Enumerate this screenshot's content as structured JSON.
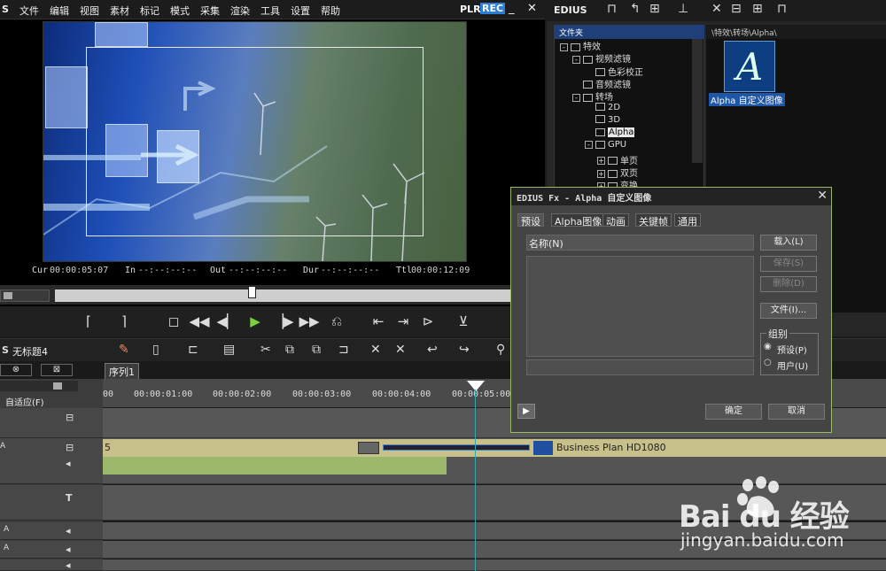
{
  "menu": [
    "S",
    "文件",
    "编辑",
    "视图",
    "素材",
    "标记",
    "模式",
    "采集",
    "渲染",
    "工具",
    "设置",
    "帮助"
  ],
  "plr": "PLR",
  "rec": "REC",
  "timecode": {
    "cur_label": "Cur",
    "cur": "00:00:05:07",
    "in_label": "In",
    "in": "--:--:--:--",
    "out_label": "Out",
    "out": "--:--:--:--",
    "dur_label": "Dur",
    "dur": "--:--:--:--",
    "ttl_label": "Ttl",
    "ttl": "00:00:12:09"
  },
  "bin": {
    "title": "EDIUS",
    "tree_header": "文件夹",
    "path": "\\特效\\转场\\Alpha\\",
    "tree": [
      {
        "label": "特效",
        "indent": 0,
        "box": "-"
      },
      {
        "label": "视频滤镜",
        "indent": 1,
        "box": "-"
      },
      {
        "label": "色彩校正",
        "indent": 2,
        "box": ""
      },
      {
        "label": "音频滤镜",
        "indent": 1,
        "box": ""
      },
      {
        "label": "转场",
        "indent": 1,
        "box": "-"
      },
      {
        "label": "2D",
        "indent": 2,
        "box": ""
      },
      {
        "label": "3D",
        "indent": 2,
        "box": ""
      },
      {
        "label": "Alpha",
        "indent": 2,
        "box": "",
        "selected": true
      },
      {
        "label": "GPU",
        "indent": 2,
        "box": "-"
      },
      {
        "label": "单页",
        "indent": 3,
        "box": "+"
      },
      {
        "label": "双页",
        "indent": 3,
        "box": "+"
      },
      {
        "label": "变换",
        "indent": 3,
        "box": "+"
      }
    ],
    "item_letter": "A",
    "item_label": "Alpha 自定义图像"
  },
  "timeline": {
    "project": "无标题4",
    "sequence_tab": "序列1",
    "fit_label": "自适应(F)",
    "ruler": [
      "00",
      "00:00:01:00",
      "00:00:02:00",
      "00:00:03:00",
      "00:00:04:00",
      "00:00:05:00"
    ],
    "clip_name": "Business Plan HD1080",
    "clip_prefix": "5"
  },
  "dialog": {
    "title": "EDIUS Fx - Alpha 自定义图像",
    "close": "✕",
    "tabs": [
      "预设",
      "Alpha图像",
      "动画",
      "关键帧",
      "通用"
    ],
    "name_label": "名称(N)",
    "buttons": {
      "load": "载入(L)",
      "save": "保存(S)",
      "delete": "删除(D)",
      "file": "文件(I)...",
      "ok": "确定",
      "cancel": "取消"
    },
    "group_label": "组别",
    "radio_preset": "预设(P)",
    "radio_user": "用户(U)"
  },
  "watermark": {
    "brand": "Bai du 经验",
    "url": "jingyan.baidu.com"
  }
}
